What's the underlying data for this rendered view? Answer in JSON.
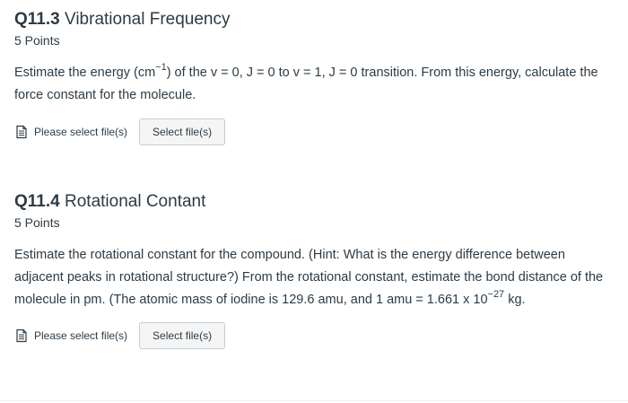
{
  "questions": [
    {
      "number": "Q11.3",
      "title": "Vibrational Frequency",
      "points": "5 Points",
      "body_part1": "Estimate the energy (cm",
      "body_sup1": "−1",
      "body_part2": ") of the v = 0, J = 0 to v = 1, J = 0 transition. From this energy, calculate the force constant for the molecule.",
      "file_label": "Please select file(s)",
      "button_label": "Select file(s)",
      "icon": "file-document-icon"
    },
    {
      "number": "Q11.4",
      "title": "Rotational Contant",
      "points": "5 Points",
      "body_part1": "Estimate the rotational constant for the compound.  (Hint: What is the energy difference between adjacent peaks in rotational structure?)  From the rotational constant, estimate the bond distance of the molecule in pm. (The atomic mass of iodine is 129.6 amu, and 1 amu = 1.661 x 10",
      "body_sup1": "−27",
      "body_part2": " kg.",
      "file_label": "Please select file(s)",
      "button_label": "Select file(s)",
      "icon": "file-document-icon"
    }
  ],
  "colors": {
    "text": "#2d3b45",
    "button_bg": "#f5f5f5",
    "button_border": "#c7cdd1"
  }
}
